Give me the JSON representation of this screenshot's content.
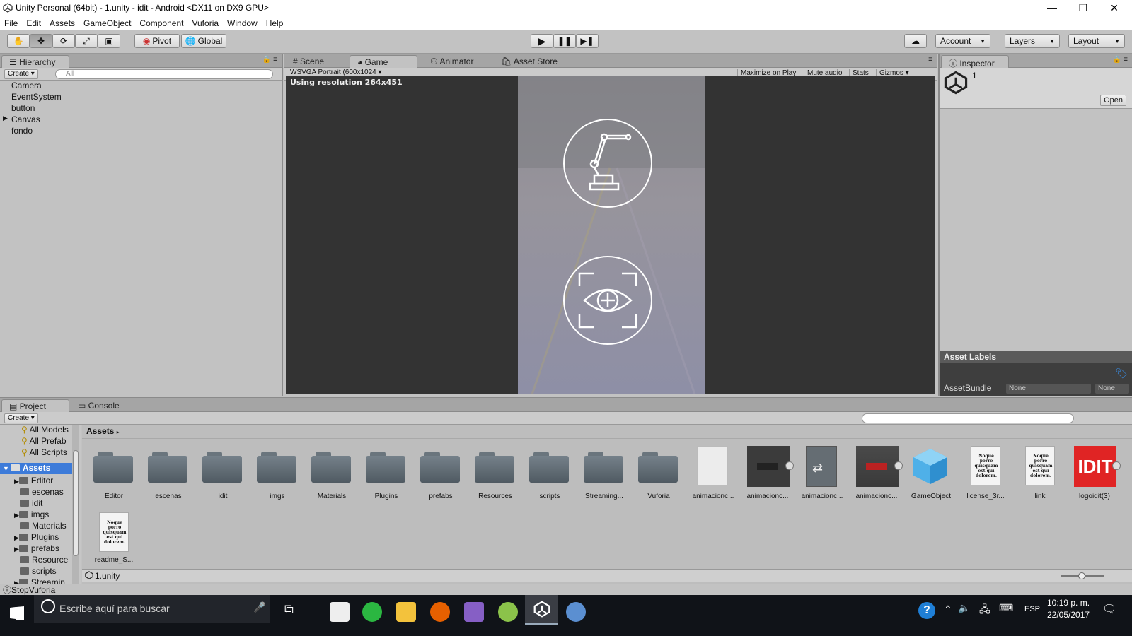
{
  "window": {
    "title": "Unity Personal (64bit) - 1.unity - idit - Android <DX11 on DX9 GPU>",
    "minimize": "—",
    "restore": "❐",
    "close": "✕"
  },
  "menu": [
    "File",
    "Edit",
    "Assets",
    "GameObject",
    "Component",
    "Vuforia",
    "Window",
    "Help"
  ],
  "toolbar": {
    "pivot": "Pivot",
    "global": "Global",
    "account": "Account",
    "layers": "Layers",
    "layout": "Layout"
  },
  "hierarchy": {
    "tab": "Hierarchy",
    "create": "Create",
    "search_placeholder": "All",
    "items": [
      "Camera",
      "EventSystem",
      "button",
      "Canvas",
      "fondo"
    ]
  },
  "center_tabs": [
    "Scene",
    "Game",
    "Animator",
    "Asset Store"
  ],
  "game": {
    "resolution_dropdown": "WSVGA Portrait (600x1024",
    "maximize": "Maximize on Play",
    "mute": "Mute audio",
    "stats": "Stats",
    "gizmos": "Gizmos",
    "overlay": "Using resolution 264x451"
  },
  "inspector": {
    "tab": "Inspector",
    "object_name": "1",
    "open_button": "Open",
    "asset_labels": "Asset Labels",
    "assetbundle_label": "AssetBundle",
    "assetbundle_value": "None",
    "variant_value": "None"
  },
  "project": {
    "tab": "Project",
    "console_tab": "Console",
    "create": "Create",
    "favorites": [
      "All Models",
      "All Prefab",
      "All Scripts"
    ],
    "root": "Assets",
    "tree": [
      "Editor",
      "escenas",
      "idit",
      "imgs",
      "Materials",
      "Plugins",
      "prefabs",
      "Resource",
      "scripts",
      "Streamin"
    ],
    "breadcrumb": "Assets",
    "assets_row1": [
      "Editor",
      "escenas",
      "idit",
      "imgs",
      "Materials",
      "Plugins",
      "prefabs",
      "Resources",
      "scripts",
      "Streaming...",
      "Vuforia",
      "animacionc...",
      "animacionc...",
      "animacionc...",
      "animacionc...",
      "GameObject",
      "license_3r...",
      "link",
      "logoidit(3)"
    ],
    "assets_row2": [
      "readme_S..."
    ],
    "doc_text": "Noque porro quisquam est qui dolorem.",
    "logo_text": "IDIT",
    "selected_file": "1.unity"
  },
  "status": "StopVuforia",
  "taskbar": {
    "search_placeholder": "Escribe aquí para buscar",
    "lang": "ESP",
    "time": "10:19 p. m.",
    "date": "22/05/2017"
  }
}
